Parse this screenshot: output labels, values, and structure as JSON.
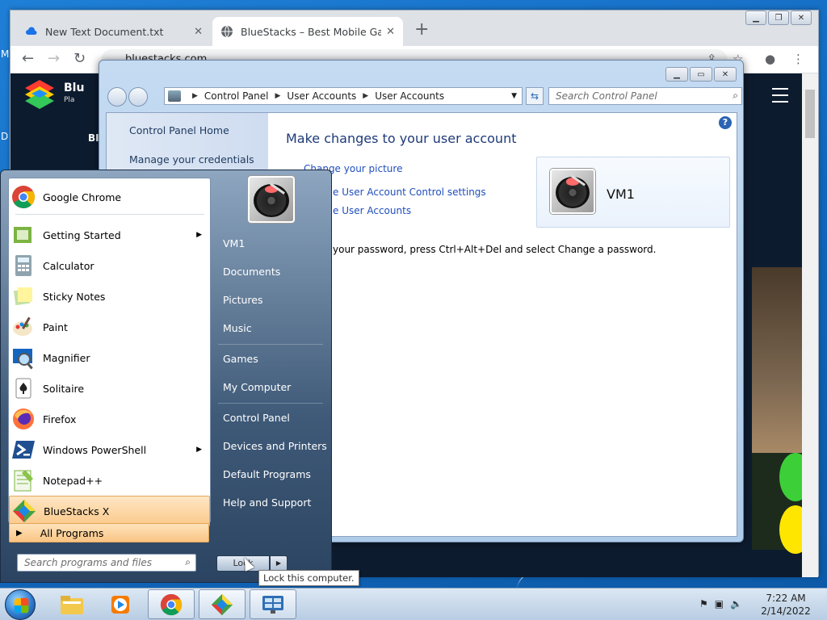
{
  "desktop": {
    "edge_letters": [
      "M",
      "D"
    ]
  },
  "chrome": {
    "tabs": [
      {
        "title": "New Text Document.txt",
        "icon": "cloud-icon"
      },
      {
        "title": "BlueStacks – Best Mobile Gaming",
        "icon": "globe-icon"
      }
    ],
    "new_tab": "+",
    "close_glyph": "✕",
    "url": "bluestacks.com",
    "nav": {
      "back": "←",
      "forward": "→",
      "reload": "↻"
    }
  },
  "page": {
    "brand": "Blu",
    "brand_sub": "Pla",
    "side_letter": "BI"
  },
  "control_panel": {
    "breadcrumb": [
      "Control Panel",
      "User Accounts",
      "User Accounts"
    ],
    "search_placeholder": "Search Control Panel",
    "left_links": [
      "Control Panel Home",
      "Manage your credentials"
    ],
    "title": "Make changes to your user account",
    "links": [
      "Change your picture",
      "e User Account Control settings",
      "e User Accounts"
    ],
    "note": "your password, press Ctrl+Alt+Del and select Change a password.",
    "user_name": "VM1",
    "help": "?"
  },
  "start_menu": {
    "programs": [
      {
        "label": "Google Chrome",
        "icon": "chrome-icon",
        "submenu": false
      },
      {
        "label": "Getting Started",
        "icon": "getting-started-icon",
        "submenu": true
      },
      {
        "label": "Calculator",
        "icon": "calculator-icon",
        "submenu": false
      },
      {
        "label": "Sticky Notes",
        "icon": "sticky-notes-icon",
        "submenu": false
      },
      {
        "label": "Paint",
        "icon": "paint-icon",
        "submenu": false
      },
      {
        "label": "Magnifier",
        "icon": "magnifier-icon",
        "submenu": false
      },
      {
        "label": "Solitaire",
        "icon": "solitaire-icon",
        "submenu": false
      },
      {
        "label": "Firefox",
        "icon": "firefox-icon",
        "submenu": false
      },
      {
        "label": "Windows PowerShell",
        "icon": "powershell-icon",
        "submenu": true
      },
      {
        "label": "Notepad++",
        "icon": "notepadpp-icon",
        "submenu": false
      },
      {
        "label": "BlueStacks X",
        "icon": "bluestacks-icon",
        "submenu": false
      }
    ],
    "all_programs": "All Programs",
    "search_placeholder": "Search programs and files",
    "right_items": [
      "VM1",
      "Documents",
      "Pictures",
      "Music",
      "Games",
      "My Computer",
      "Control Panel",
      "Devices and Printers",
      "Default Programs",
      "Help and Support"
    ],
    "shutdown_label": "Lock",
    "tooltip": "Lock this computer."
  },
  "taskbar": {
    "pinned": [
      "explorer-icon",
      "media-player-icon",
      "chrome-icon",
      "bluestacks-icon",
      "control-panel-icon"
    ],
    "time": "7:22 AM",
    "date": "2/14/2022"
  },
  "colors": {
    "accent": "#1f4ebd",
    "highlight": "#fbc98a",
    "desktop": "#1167bd"
  }
}
